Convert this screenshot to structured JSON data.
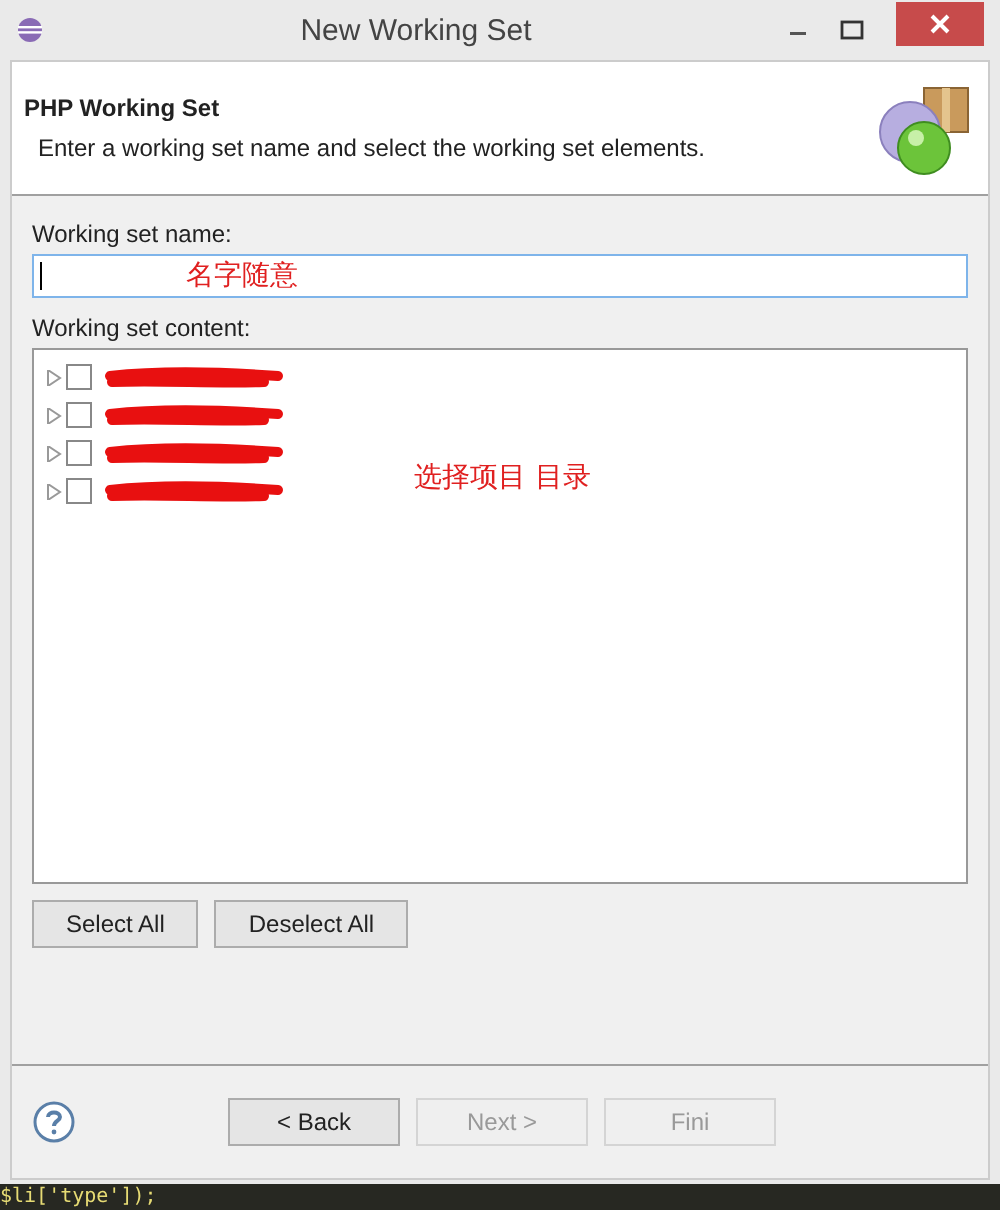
{
  "window": {
    "title": "New Working Set"
  },
  "header": {
    "title": "PHP Working Set",
    "description": "Enter a working set name and select the working set elements."
  },
  "name_field": {
    "label": "Working set name:",
    "annotation": "名字随意"
  },
  "content": {
    "label": "Working set content:",
    "annotation": "选择项目 目录",
    "items": [
      {
        "expanded": false,
        "checked": false
      },
      {
        "expanded": false,
        "checked": false
      },
      {
        "expanded": false,
        "checked": false
      },
      {
        "expanded": false,
        "checked": false
      }
    ]
  },
  "selection_buttons": [
    "Select All",
    "Deselect All"
  ],
  "footer_buttons": [
    {
      "label": "< Back",
      "disabled": false
    },
    {
      "label": "Next >",
      "disabled": true
    },
    {
      "label": "Fini",
      "disabled": true
    }
  ],
  "background_code": "$li['type']);"
}
